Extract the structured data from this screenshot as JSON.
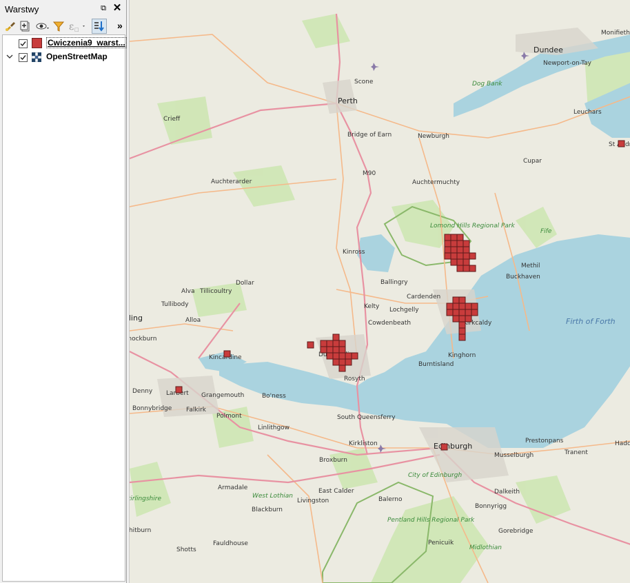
{
  "panel": {
    "title": "Warstwy",
    "float_glyph": "⧉",
    "close_glyph": "✕",
    "toolbar": {
      "more_glyph": "»",
      "icons": [
        "style-brush-icon",
        "add-group-icon",
        "visibility-eye-icon",
        "filter-icon",
        "expression-filter-icon",
        "expand-all-icon"
      ]
    },
    "layers": [
      {
        "name": "Cwiczenia9_warst...",
        "checked": true,
        "color": "#c83c3c",
        "selected": true,
        "expandable": false
      },
      {
        "name": "OpenStreetMap",
        "checked": true,
        "color": "",
        "selected": false,
        "expandable": true
      }
    ]
  },
  "map": {
    "colors": {
      "land": "#ecebe1",
      "water": "#aad3df",
      "green": "#cde6b0",
      "motorway": "#e892a2",
      "primary": "#fcd6a4",
      "feature": "#c83c3c"
    },
    "places": [
      {
        "name": "Monifieth"
      },
      {
        "name": "Dundee"
      },
      {
        "name": "Newport-on-Tay"
      },
      {
        "name": "Scone"
      },
      {
        "name": "Perth"
      },
      {
        "name": "Leuchars"
      },
      {
        "name": "Crieff"
      },
      {
        "name": "Bridge of Earn"
      },
      {
        "name": "Newburgh"
      },
      {
        "name": "St Andrews"
      },
      {
        "name": "M90"
      },
      {
        "name": "Cupar"
      },
      {
        "name": "Auchterarder"
      },
      {
        "name": "Auchtermuchty"
      },
      {
        "name": "Fife"
      },
      {
        "name": "Kinross"
      },
      {
        "name": "Methil"
      },
      {
        "name": "Buckhaven"
      },
      {
        "name": "Dollar"
      },
      {
        "name": "Ballingry"
      },
      {
        "name": "Alva"
      },
      {
        "name": "Tillicoultry"
      },
      {
        "name": "Tullibody"
      },
      {
        "name": "Kelty"
      },
      {
        "name": "Cardenden"
      },
      {
        "name": "Lochgelly"
      },
      {
        "name": "Alloa"
      },
      {
        "name": "Cowdenbeath"
      },
      {
        "name": "Kirkcaldy"
      },
      {
        "name": "Stirling"
      },
      {
        "name": "Bannockburn"
      },
      {
        "name": "Kincardine"
      },
      {
        "name": "Dunfermline"
      },
      {
        "name": "Kinghorn"
      },
      {
        "name": "Burntisland"
      },
      {
        "name": "Rosyth"
      },
      {
        "name": "Denny"
      },
      {
        "name": "Larbert"
      },
      {
        "name": "Grangemouth"
      },
      {
        "name": "Bo'ness"
      },
      {
        "name": "Bonnybridge"
      },
      {
        "name": "Falkirk"
      },
      {
        "name": "Polmont"
      },
      {
        "name": "South Queensferry"
      },
      {
        "name": "Linlithgow"
      },
      {
        "name": "Kirkliston"
      },
      {
        "name": "Edinburgh"
      },
      {
        "name": "Prestonpans"
      },
      {
        "name": "Broxburn"
      },
      {
        "name": "Musselburgh"
      },
      {
        "name": "Tranent"
      },
      {
        "name": "Haddington"
      },
      {
        "name": "Armadale"
      },
      {
        "name": "East Calder"
      },
      {
        "name": "West Lothian"
      },
      {
        "name": "City of Edinburgh"
      },
      {
        "name": "Dalkeith"
      },
      {
        "name": "Blackburn"
      },
      {
        "name": "Livingston"
      },
      {
        "name": "Balerno"
      },
      {
        "name": "Bonnyrigg"
      },
      {
        "name": "Whitburn"
      },
      {
        "name": "Gorebridge"
      },
      {
        "name": "Shotts"
      },
      {
        "name": "Fauldhouse"
      },
      {
        "name": "Penicuik"
      },
      {
        "name": "Midlothian"
      },
      {
        "name": "Stirlingshire"
      }
    ],
    "parks": [
      "Lomond Hills Regional Park",
      "Pentland Hills Regional Park"
    ],
    "water_labels": [
      "Firth of Forth",
      "Dog Bank"
    ]
  }
}
